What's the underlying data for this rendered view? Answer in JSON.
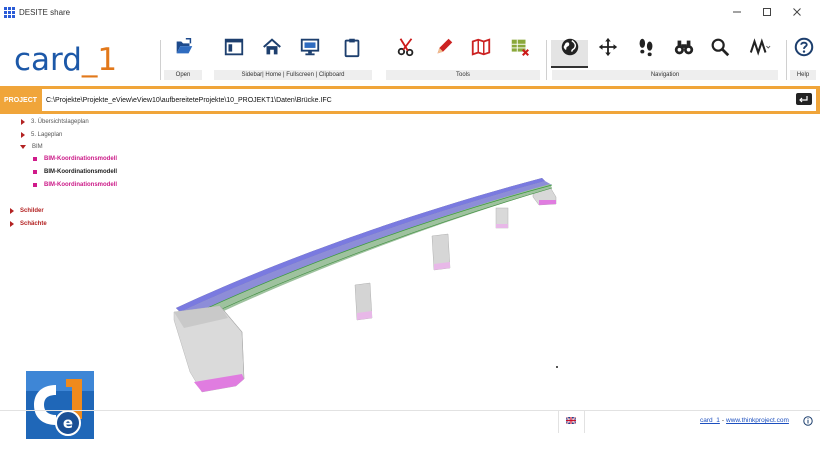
{
  "window": {
    "title": "DESITE share",
    "controls": [
      "minimize",
      "maximize",
      "close"
    ]
  },
  "brand": {
    "text_main": "card",
    "text_accent": "_1",
    "color_main": "#1c58a8",
    "color_accent": "#e2781a"
  },
  "ribbon": {
    "buttons": [
      {
        "name": "open",
        "icon": "open-folder-icon"
      },
      {
        "name": "sidebar",
        "icon": "sidebar-window-icon"
      },
      {
        "name": "home",
        "icon": "home-icon"
      },
      {
        "name": "fullscreen",
        "icon": "fullscreen-monitor-icon"
      },
      {
        "name": "clipboard",
        "icon": "clipboard-icon"
      },
      {
        "name": "cut",
        "icon": "scissors-icon"
      },
      {
        "name": "markup",
        "icon": "pencil-icon"
      },
      {
        "name": "map",
        "icon": "map-icon"
      },
      {
        "name": "table-delete",
        "icon": "table-delete-icon"
      },
      {
        "name": "orbit",
        "icon": "globe-icon"
      },
      {
        "name": "pan",
        "icon": "move-arrows-icon"
      },
      {
        "name": "walk",
        "icon": "footsteps-icon"
      },
      {
        "name": "fly",
        "icon": "binoculars-icon"
      },
      {
        "name": "zoom",
        "icon": "magnifier-icon"
      },
      {
        "name": "mode",
        "icon": "zigzag-mode-icon"
      },
      {
        "name": "help",
        "icon": "help-circle-icon"
      }
    ],
    "groups": {
      "open": "Open",
      "view": "Sidebar| Home | Fullscreen | Clipboard",
      "tools": "Tools",
      "navigation": "Navigation",
      "help": "Help"
    }
  },
  "project": {
    "label": "PROJECT",
    "path": "C:\\Projekte\\Projekte_eView\\eView10\\aufbereiteteProjekte\\10_PROJEKT1\\Daten\\Brücke.IFC",
    "accent": "#f0a53a"
  },
  "tree": {
    "items": [
      {
        "label": "3. Übersichtslageplan"
      },
      {
        "label": "5. Lageplan"
      },
      {
        "label": "BIM"
      },
      {
        "label": "BIM-Koordinationsmodell"
      },
      {
        "label": "BIM-Koordinationsmodell"
      },
      {
        "label": "BIM-Koordinationsmodell"
      },
      {
        "label": "Schilder"
      },
      {
        "label": "Schächte"
      }
    ]
  },
  "statusbar": {
    "link1": "card_1",
    "separator": "-",
    "link2": "www.thinkproject.com",
    "language_flag": "uk-flag-icon"
  }
}
